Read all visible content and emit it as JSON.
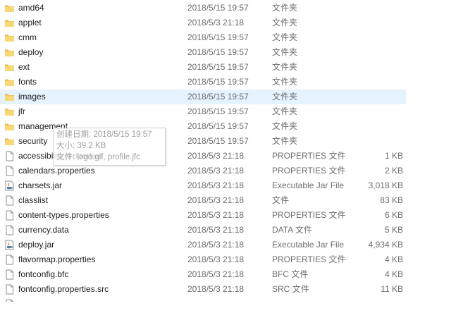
{
  "files": [
    {
      "name": "amd64",
      "date": "2018/5/15 19:57",
      "type": "文件夹",
      "size": "",
      "icon": "folder-icon"
    },
    {
      "name": "applet",
      "date": "2018/5/3 21:18",
      "type": "文件夹",
      "size": "",
      "icon": "folder-icon"
    },
    {
      "name": "cmm",
      "date": "2018/5/15 19:57",
      "type": "文件夹",
      "size": "",
      "icon": "folder-icon"
    },
    {
      "name": "deploy",
      "date": "2018/5/15 19:57",
      "type": "文件夹",
      "size": "",
      "icon": "folder-icon"
    },
    {
      "name": "ext",
      "date": "2018/5/15 19:57",
      "type": "文件夹",
      "size": "",
      "icon": "folder-icon"
    },
    {
      "name": "fonts",
      "date": "2018/5/15 19:57",
      "type": "文件夹",
      "size": "",
      "icon": "folder-icon"
    },
    {
      "name": "images",
      "date": "2018/5/15 19:57",
      "type": "文件夹",
      "size": "",
      "icon": "folder-icon",
      "hover": true
    },
    {
      "name": "jfr",
      "date": "2018/5/15 19:57",
      "type": "文件夹",
      "size": "",
      "icon": "folder-icon"
    },
    {
      "name": "management",
      "date": "2018/5/15 19:57",
      "type": "文件夹",
      "size": "",
      "icon": "folder-icon"
    },
    {
      "name": "security",
      "date": "2018/5/15 19:57",
      "type": "文件夹",
      "size": "",
      "icon": "folder-icon"
    },
    {
      "name": "accessibility.properties",
      "date": "2018/5/3 21:18",
      "type": "PROPERTIES 文件",
      "size": "1 KB",
      "icon": "file-icon"
    },
    {
      "name": "calendars.properties",
      "date": "2018/5/3 21:18",
      "type": "PROPERTIES 文件",
      "size": "2 KB",
      "icon": "file-icon"
    },
    {
      "name": "charsets.jar",
      "date": "2018/5/3 21:18",
      "type": "Executable Jar File",
      "size": "3,018 KB",
      "icon": "jar-icon"
    },
    {
      "name": "classlist",
      "date": "2018/5/3 21:18",
      "type": "文件",
      "size": "83 KB",
      "icon": "file-icon"
    },
    {
      "name": "content-types.properties",
      "date": "2018/5/3 21:18",
      "type": "PROPERTIES 文件",
      "size": "6 KB",
      "icon": "file-icon"
    },
    {
      "name": "currency.data",
      "date": "2018/5/3 21:18",
      "type": "DATA 文件",
      "size": "5 KB",
      "icon": "file-icon"
    },
    {
      "name": "deploy.jar",
      "date": "2018/5/3 21:18",
      "type": "Executable Jar File",
      "size": "4,934 KB",
      "icon": "jar-icon"
    },
    {
      "name": "flavormap.properties",
      "date": "2018/5/3 21:18",
      "type": "PROPERTIES 文件",
      "size": "4 KB",
      "icon": "file-icon"
    },
    {
      "name": "fontconfig.bfc",
      "date": "2018/5/3 21:18",
      "type": "BFC 文件",
      "size": "4 KB",
      "icon": "file-icon"
    },
    {
      "name": "fontconfig.properties.src",
      "date": "2018/5/3 21:18",
      "type": "SRC 文件",
      "size": "11 KB",
      "icon": "file-icon"
    },
    {
      "name": "",
      "date": "",
      "type": "",
      "size": "",
      "icon": "file-icon",
      "partial": true
    }
  ],
  "tooltip": {
    "created": "创建日期: 2018/5/15 19:57",
    "size": "大小: 39.2 KB",
    "files": "文件: logo.gif, profile.jfc"
  },
  "colors": {
    "hover": "#e5f3ff",
    "folder": "#f8d775",
    "secondary_text": "#6d6d6d"
  }
}
